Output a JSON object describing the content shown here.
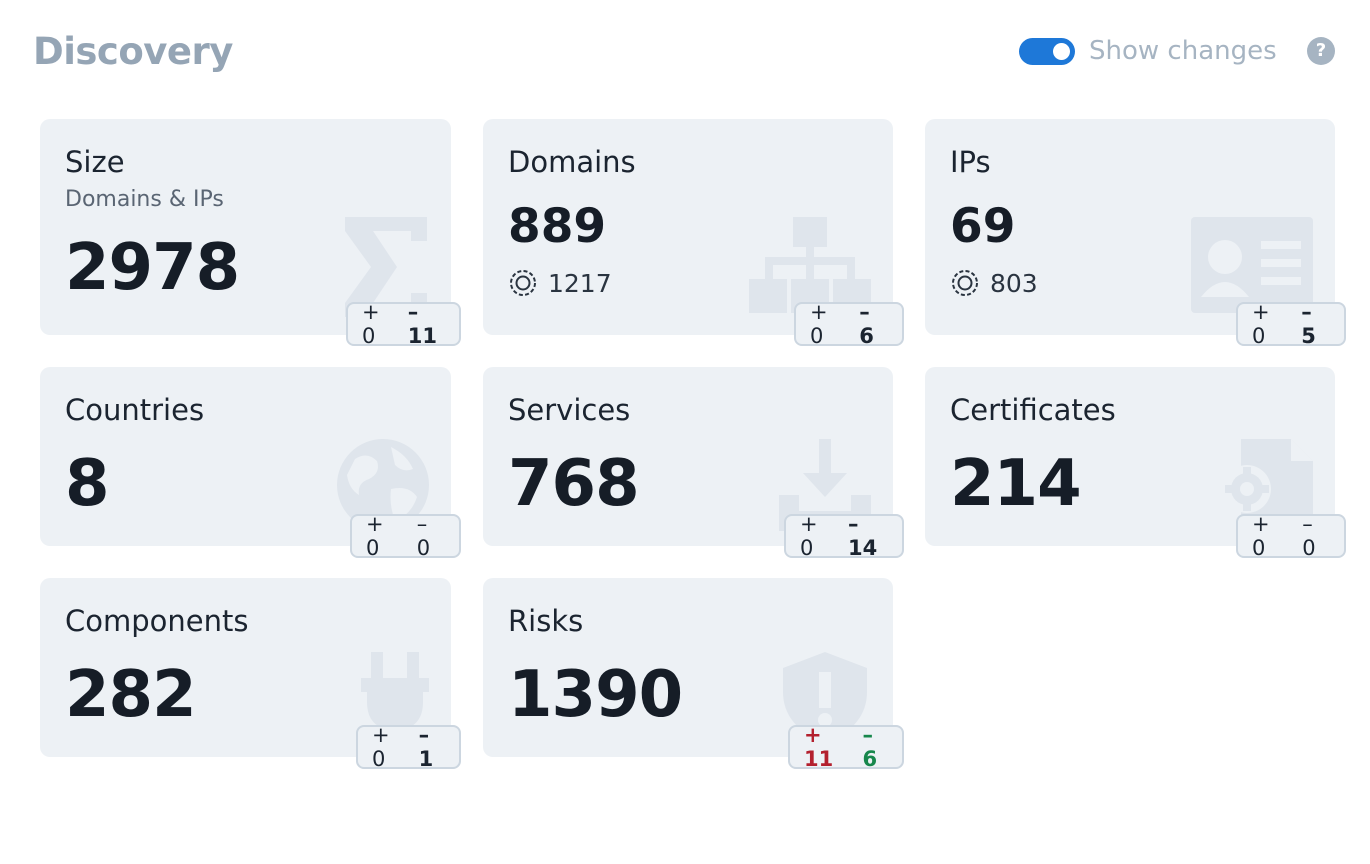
{
  "header": {
    "title": "Discovery",
    "toggle_label": "Show changes",
    "toggle_on": true,
    "help_label": "?"
  },
  "cards": {
    "size": {
      "title": "Size",
      "subtitle": "Domains & IPs",
      "value": "2978",
      "plus": "+ 0",
      "minus": "– 11",
      "icon": "sigma-icon"
    },
    "domains": {
      "title": "Domains",
      "value": "889",
      "secondary": "1217",
      "plus": "+ 0",
      "minus": "– 6",
      "icon": "sitemap-icon"
    },
    "ips": {
      "title": "IPs",
      "value": "69",
      "secondary": "803",
      "plus": "+ 0",
      "minus": "– 5",
      "icon": "id-card-icon"
    },
    "countries": {
      "title": "Countries",
      "value": "8",
      "plus": "+ 0",
      "minus": "– 0",
      "icon": "globe-icon"
    },
    "services": {
      "title": "Services",
      "value": "768",
      "plus": "+ 0",
      "minus": "– 14",
      "icon": "download-icon"
    },
    "certificates": {
      "title": "Certificates",
      "value": "214",
      "plus": "+ 0",
      "minus": "– 0",
      "icon": "certificate-gear-icon"
    },
    "components": {
      "title": "Components",
      "value": "282",
      "plus": "+ 0",
      "minus": "– 1",
      "icon": "plug-icon"
    },
    "risks": {
      "title": "Risks",
      "value": "1390",
      "plus": "+ 11",
      "minus": "– 6",
      "icon": "shield-alert-icon"
    }
  },
  "colors": {
    "accent": "#1e78d8",
    "risk_plus": "#b3202e",
    "risk_minus": "#17874c",
    "card_bg": "#edf1f5"
  }
}
